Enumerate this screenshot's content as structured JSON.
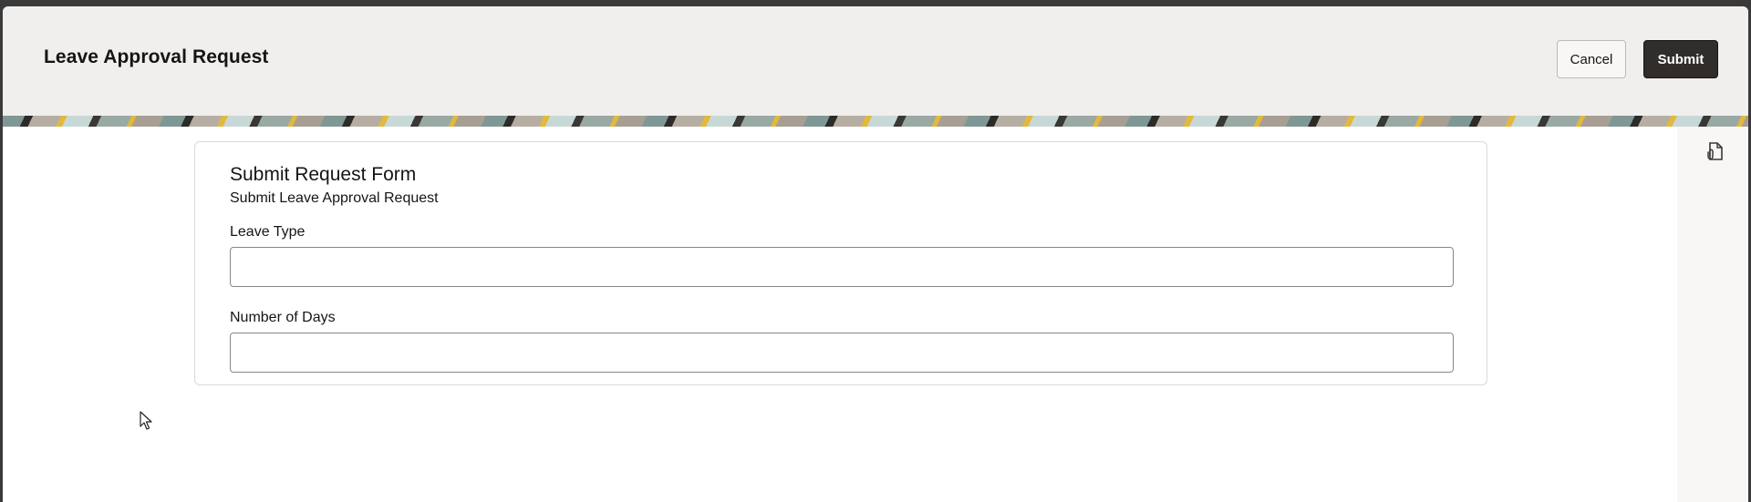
{
  "header": {
    "title": "Leave Approval Request",
    "cancel_label": "Cancel",
    "submit_label": "Submit"
  },
  "form": {
    "title": "Submit Request Form",
    "subtitle": "Submit Leave Approval Request",
    "fields": [
      {
        "label": "Leave Type",
        "value": "",
        "placeholder": ""
      },
      {
        "label": "Number of Days",
        "value": "",
        "placeholder": ""
      }
    ]
  },
  "icons": {
    "attachment": "attachment-icon",
    "cursor": "mouse-pointer-icon"
  },
  "colors": {
    "header_bg": "#f1efed",
    "primary_button": "#312d2a",
    "text": "#161513"
  }
}
